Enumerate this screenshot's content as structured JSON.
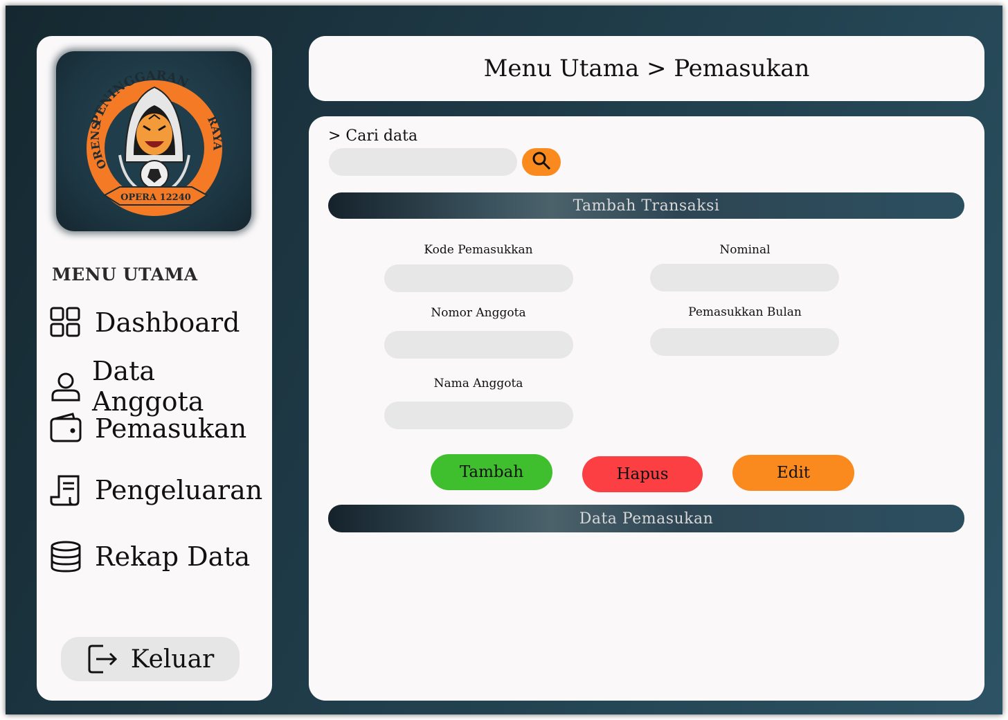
{
  "header": {
    "title": "Menu Utama > Pemasukan"
  },
  "sidebar": {
    "logo": {
      "top_text": "PENINGGARAN",
      "left_text": "ORENS",
      "right_text": "RAYA",
      "banner_text": "OPERA 12240"
    },
    "menu_title": "MENU UTAMA",
    "items": [
      {
        "label": "Dashboard",
        "icon": "dashboard-grid-icon"
      },
      {
        "label": "Data Anggota",
        "icon": "user-icon"
      },
      {
        "label": "Pemasukan",
        "icon": "wallet-icon"
      },
      {
        "label": "Pengeluaran",
        "icon": "receipt-icon"
      },
      {
        "label": "Rekap Data",
        "icon": "database-icon"
      }
    ],
    "logout": {
      "label": "Keluar",
      "icon": "logout-icon"
    }
  },
  "search": {
    "label": "> Cari data",
    "value": "",
    "icon": "search-icon"
  },
  "form": {
    "section_title": "Tambah Transaksi",
    "fields": {
      "kode": {
        "label": "Kode Pemasukkan",
        "value": ""
      },
      "nomor": {
        "label": "Nomor Anggota",
        "value": ""
      },
      "nama": {
        "label": "Nama Anggota",
        "value": ""
      },
      "nominal": {
        "label": "Nominal",
        "value": ""
      },
      "bulan": {
        "label": "Pemasukkan Bulan",
        "value": ""
      }
    },
    "buttons": {
      "tambah": "Tambah",
      "hapus": "Hapus",
      "edit": "Edit"
    }
  },
  "table": {
    "section_title": "Data Pemasukan"
  },
  "colors": {
    "accent_orange": "#fb8a1e",
    "add_green": "#40bf2e",
    "delete_red": "#fb3f42",
    "panel_bg": "#faf8f9",
    "input_bg": "#e7e7e7"
  }
}
